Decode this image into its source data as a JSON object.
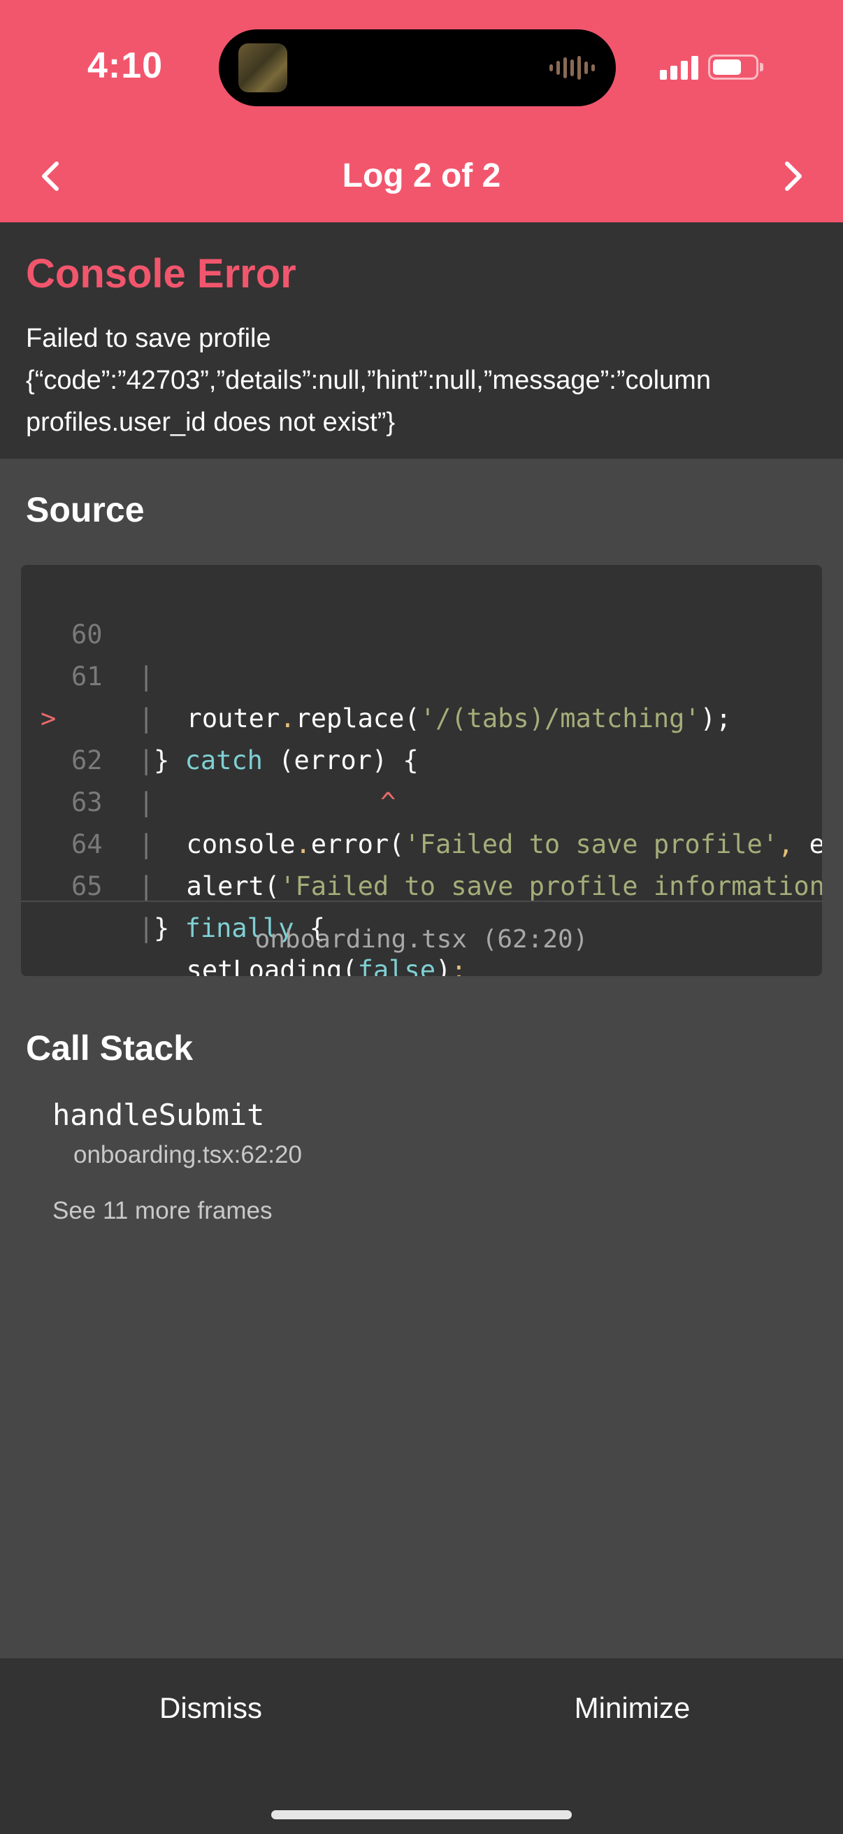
{
  "status_bar": {
    "time": "4:10"
  },
  "header": {
    "title": "Log 2 of 2",
    "prev_icon": "chevron-left-icon",
    "next_icon": "chevron-right-icon"
  },
  "error": {
    "title": "Console Error",
    "message_line1": "Failed to save profile",
    "message_line2": "{“code”:”42703”,”details”:null,”hint”:null,”message”:”column profiles.user_id does not exist”}"
  },
  "source": {
    "heading": "Source",
    "lines": [
      {
        "marker": "",
        "num": "60",
        "bar": "|",
        "a": "  router",
        "b": ".",
        "c": "replace(",
        "d": "'/(tabs)/matching'",
        "e": ");"
      },
      {
        "marker": "",
        "num": "61",
        "bar": "|",
        "a": "} ",
        "kw": "catch",
        "c": " (error) {"
      },
      {
        "marker": ">",
        "num": "62",
        "bar": "|",
        "a": "  console",
        "b": ".",
        "c": "error(",
        "d": "'Failed to save profile'",
        "e": ", er"
      },
      {
        "marker": "",
        "num": "",
        "bar": "|",
        "caret": "^"
      },
      {
        "marker": "",
        "num": "63",
        "bar": "|",
        "a": "  alert(",
        "d": "'Failed to save profile information."
      },
      {
        "marker": "",
        "num": "64",
        "bar": "|",
        "a": "} ",
        "kw": "finally",
        "c": " {"
      },
      {
        "marker": "",
        "num": "65",
        "bar": "|",
        "a": "  setLoading(",
        "kw": "false",
        "c": ")",
        "e": ";"
      }
    ],
    "file_ref": "onboarding.tsx (62:20)"
  },
  "call_stack": {
    "heading": "Call Stack",
    "frames": [
      {
        "function": "handleSubmit",
        "location": "onboarding.tsx:62:20"
      }
    ],
    "more_label": "See 11 more frames"
  },
  "footer": {
    "dismiss_label": "Dismiss",
    "minimize_label": "Minimize"
  },
  "colors": {
    "accent": "#f2566d",
    "panel": "#333333",
    "background": "#474747"
  }
}
